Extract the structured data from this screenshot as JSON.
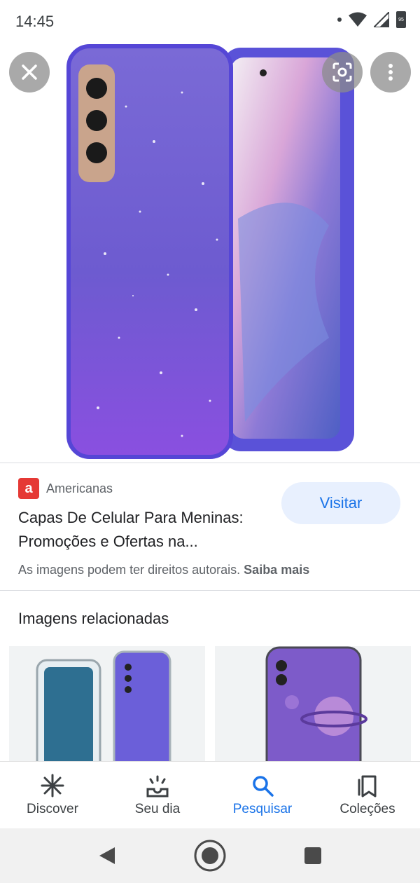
{
  "status": {
    "time": "14:45",
    "battery": "95"
  },
  "hero": {
    "close_icon": "close-icon",
    "lens_icon": "lens-icon",
    "more_icon": "more-vert-icon"
  },
  "result": {
    "source_name": "Americanas",
    "source_logo_letter": "a",
    "title": "Capas De Celular Para Meninas: Promoções e Ofertas na...",
    "visit_label": "Visitar",
    "copyright_text": "As imagens podem ter direitos autorais.",
    "learn_more": "Saiba mais"
  },
  "related": {
    "heading": "Imagens relacionadas"
  },
  "bottom_nav": {
    "items": [
      {
        "label": "Discover",
        "icon": "asterisk-icon"
      },
      {
        "label": "Seu dia",
        "icon": "sunrise-icon"
      },
      {
        "label": "Pesquisar",
        "icon": "search-icon"
      },
      {
        "label": "Coleções",
        "icon": "collections-icon"
      }
    ],
    "active": "Pesquisar"
  },
  "colors": {
    "accent": "#1a73e8",
    "visit_bg": "#e8f0fe",
    "logo_red": "#e53935"
  }
}
